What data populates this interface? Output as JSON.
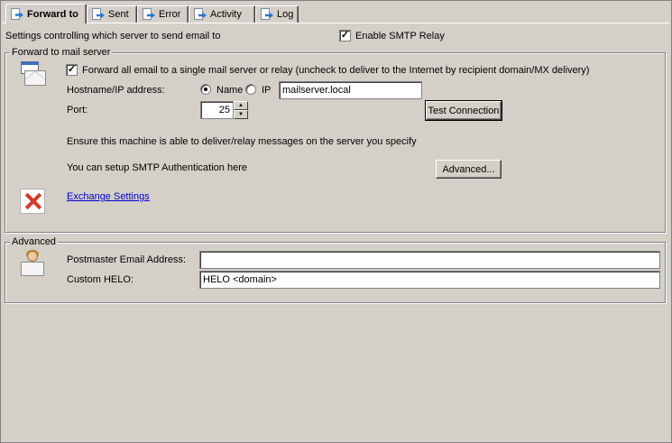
{
  "tabs": [
    {
      "label": "Forward to",
      "active": true
    },
    {
      "label": "Sent",
      "active": false
    },
    {
      "label": "Error",
      "active": false
    },
    {
      "label": "Activity",
      "active": false
    },
    {
      "label": "Log",
      "active": false
    }
  ],
  "header": {
    "description": "Settings controlling which server to send email to",
    "enable_relay_label": "Enable SMTP Relay",
    "enable_relay_checked": true
  },
  "forward_group": {
    "legend": "Forward to mail server",
    "forward_all_label": "Forward all email to a single mail server or relay (uncheck to deliver to the Internet by recipient domain/MX delivery)",
    "forward_all_checked": true,
    "hostname_label": "Hostname/IP address:",
    "radio_name_label": "Name",
    "radio_ip_label": "IP",
    "selected_mode": "Name",
    "hostname_value": "mailserver.local",
    "port_label": "Port:",
    "port_value": "25",
    "test_button": "Test Connection",
    "ensure_text": "Ensure this machine is able to deliver/relay messages on the server you specify",
    "auth_text": "You can setup SMTP Authentication here",
    "advanced_button": "Advanced...",
    "exchange_link": "Exchange Settings"
  },
  "advanced_group": {
    "legend": "Advanced",
    "postmaster_label": "Postmaster Email Address:",
    "postmaster_value": "",
    "helo_label": "Custom HELO:",
    "helo_value": "HELO <domain>"
  },
  "icons": {
    "tab_icon": "forward-page-icon",
    "forward_icon": "mail-window-icon",
    "exchange_icon": "exchange-icon",
    "advanced_icon": "postmaster-icon"
  }
}
